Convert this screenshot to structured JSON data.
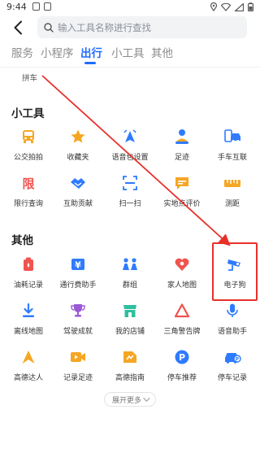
{
  "status_bar": {
    "time": "9:44"
  },
  "search": {
    "placeholder": "输入工具名称进行查找"
  },
  "tabs": [
    {
      "label": "服务",
      "active": false
    },
    {
      "label": "小程序",
      "active": false
    },
    {
      "label": "出行",
      "active": true
    },
    {
      "label": "小工具",
      "active": false
    },
    {
      "label": "其他",
      "active": false
    }
  ],
  "partial_item": {
    "label": "拼车"
  },
  "sections": {
    "tools": {
      "title": "小工具",
      "items": [
        {
          "label": "公交拍拍",
          "icon": "bus-camera-icon",
          "color": "#f5a623"
        },
        {
          "label": "收藏夹",
          "icon": "star-icon",
          "color": "#f5a623"
        },
        {
          "label": "语音包设置",
          "icon": "voice-pack-icon",
          "color": "#2f7bff"
        },
        {
          "label": "足迹",
          "icon": "footprint-icon",
          "color": "#2f7bff"
        },
        {
          "label": "手车互联",
          "icon": "phone-car-icon",
          "color": "#2f7bff"
        },
        {
          "label": "限行查询",
          "icon": "restriction-icon",
          "color": "#f0544f"
        },
        {
          "label": "互助贡献",
          "icon": "handshake-icon",
          "color": "#2f7bff"
        },
        {
          "label": "扫一扫",
          "icon": "scan-icon",
          "color": "#2f7bff"
        },
        {
          "label": "实地点评价",
          "icon": "comment-icon",
          "color": "#f5a623"
        },
        {
          "label": "测距",
          "icon": "ruler-icon",
          "color": "#f5a623"
        }
      ]
    },
    "other": {
      "title": "其他",
      "items": [
        {
          "label": "油耗记录",
          "icon": "fuel-icon",
          "color": "#f0544f"
        },
        {
          "label": "通行费助手",
          "icon": "toll-icon",
          "color": "#2f7bff"
        },
        {
          "label": "群组",
          "icon": "group-icon",
          "color": "#2f7bff"
        },
        {
          "label": "家人地图",
          "icon": "family-map-icon",
          "color": "#f0544f"
        },
        {
          "label": "电子狗",
          "icon": "speed-camera-icon",
          "color": "#2f7bff"
        },
        {
          "label": "离线地图",
          "icon": "download-icon",
          "color": "#2f7bff"
        },
        {
          "label": "驾驶成就",
          "icon": "trophy-icon",
          "color": "#9b59d6"
        },
        {
          "label": "我的店铺",
          "icon": "shop-icon",
          "color": "#2fbf9f"
        },
        {
          "label": "三角警告牌",
          "icon": "warning-triangle-icon",
          "color": "#f0544f"
        },
        {
          "label": "语音助手",
          "icon": "microphone-icon",
          "color": "#2f7bff"
        },
        {
          "label": "高德达人",
          "icon": "expert-icon",
          "color": "#f5a623"
        },
        {
          "label": "记录足迹",
          "icon": "video-record-icon",
          "color": "#f5a623"
        },
        {
          "label": "高德指南",
          "icon": "guide-icon",
          "color": "#f5a623"
        },
        {
          "label": "停车推荐",
          "icon": "parking-icon",
          "color": "#2f7bff"
        },
        {
          "label": "停车记录",
          "icon": "parking-record-icon",
          "color": "#2f7bff"
        }
      ]
    }
  },
  "expand_button": {
    "label": "展开更多"
  },
  "colors": {
    "accent": "#1f6dff",
    "annotation": "#e8302a"
  }
}
